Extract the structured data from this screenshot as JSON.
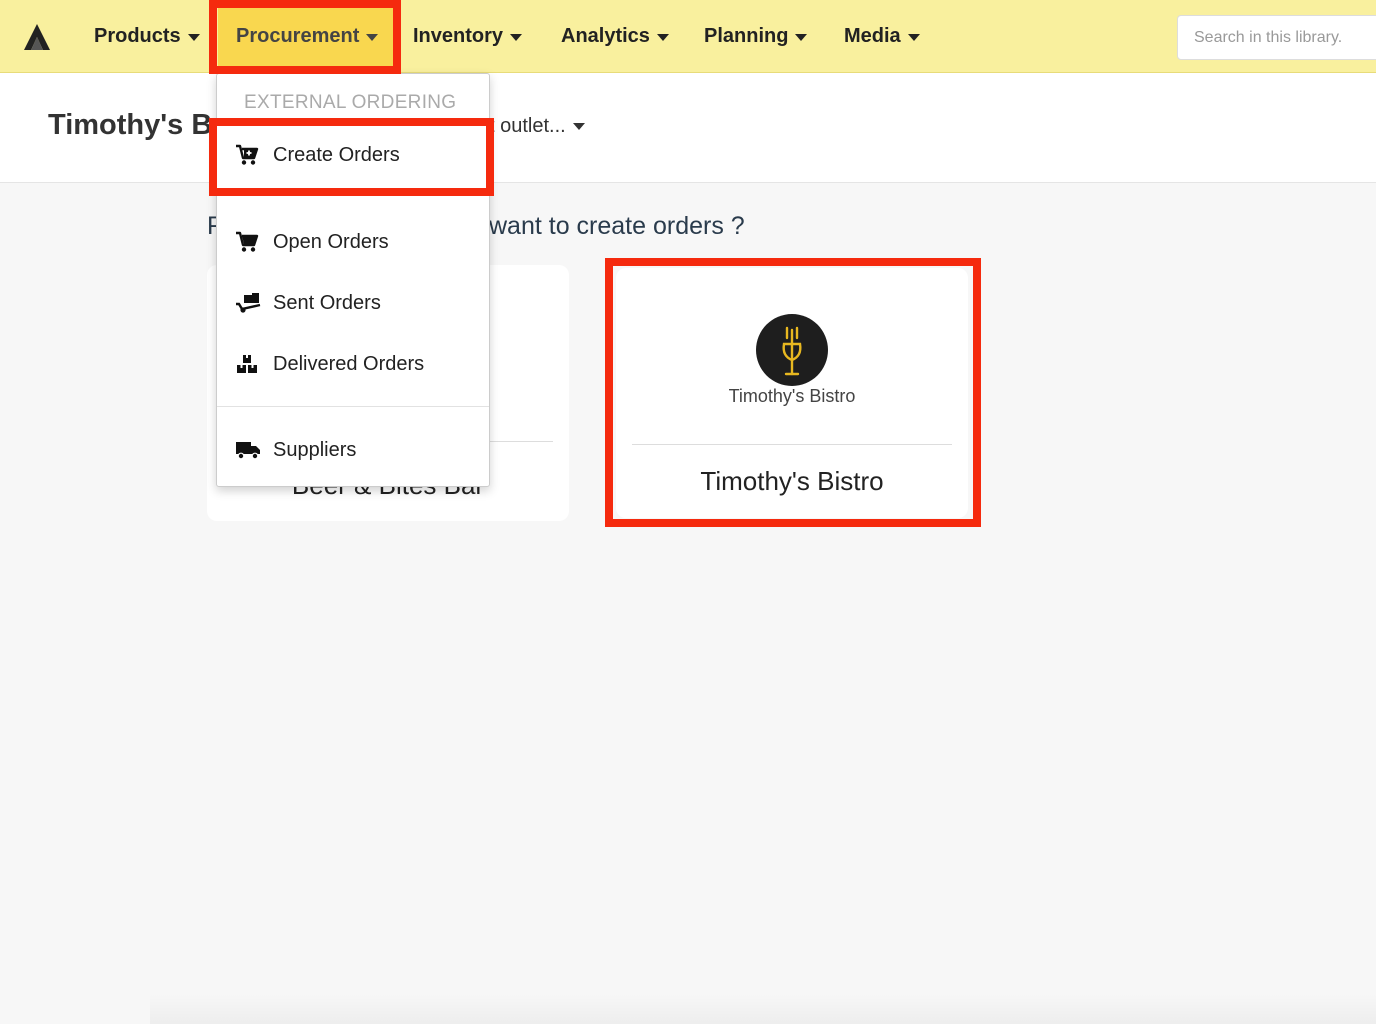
{
  "nav": {
    "logo_icon": "app-logo-icon",
    "items": [
      {
        "label": "Products"
      },
      {
        "label": "Procurement"
      },
      {
        "label": "Inventory"
      },
      {
        "label": "Analytics"
      },
      {
        "label": "Planning"
      },
      {
        "label": "Media"
      }
    ],
    "active_item": "Procurement",
    "search_placeholder": "Search in this library."
  },
  "header": {
    "company_name_visible": "Timothy's B",
    "outlet_selector_visible": "t outlet..."
  },
  "main": {
    "question_visible": "want to create orders ?",
    "question_left_fragment": "F",
    "cards": [
      {
        "title_visible": "Beer & Bites Bar"
      },
      {
        "title": "Timothy's Bistro",
        "brand_text": "Timothy's Bistro",
        "logo_icon": "fork-glass-logo"
      }
    ]
  },
  "dropdown": {
    "header": "EXTERNAL ORDERING",
    "items": [
      {
        "label": "Create Orders",
        "icon": "cart-plus-icon"
      },
      {
        "label": "Open Orders",
        "icon": "cart-icon"
      },
      {
        "label": "Sent Orders",
        "icon": "dolly-icon"
      },
      {
        "label": "Delivered Orders",
        "icon": "boxes-icon"
      },
      {
        "label": "Suppliers",
        "icon": "truck-icon"
      }
    ]
  },
  "colors": {
    "navbar_bg": "#f9f09e",
    "active_nav_bg": "#f9d74f",
    "highlight": "#f52a0e",
    "brand_gold": "#e8b820"
  }
}
